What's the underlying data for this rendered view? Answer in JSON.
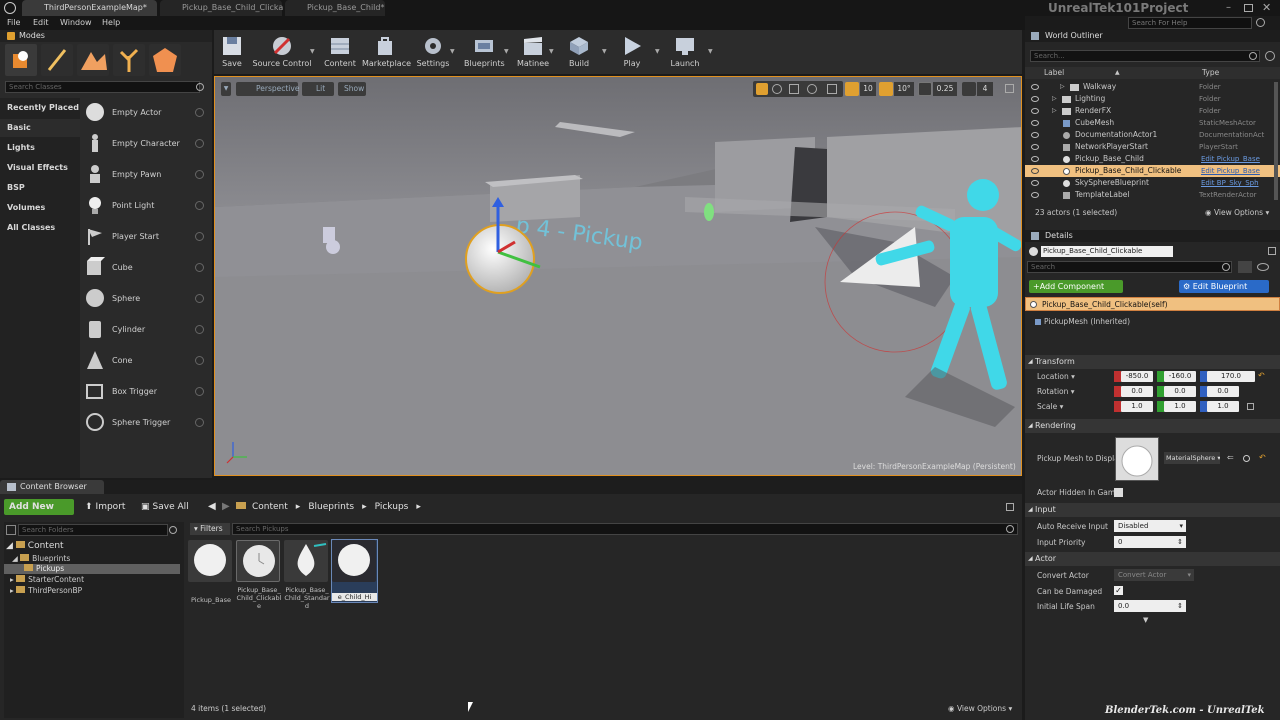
{
  "window": {
    "project": "UnrealTek101Project",
    "search_help_placeholder": "Search For Help",
    "tabs": [
      "ThirdPersonExampleMap*",
      "Pickup_Base_Child_Clicka",
      "Pickup_Base_Child*"
    ],
    "menu": [
      "File",
      "Edit",
      "Window",
      "Help"
    ]
  },
  "modes": {
    "title": "Modes",
    "search_placeholder": "Search Classes",
    "categories": [
      "Recently Placed",
      "Basic",
      "Lights",
      "Visual Effects",
      "BSP",
      "Volumes",
      "All Classes"
    ],
    "items": [
      "Empty Actor",
      "Empty Character",
      "Empty Pawn",
      "Point Light",
      "Player Start",
      "Cube",
      "Sphere",
      "Cylinder",
      "Cone",
      "Box Trigger",
      "Sphere Trigger"
    ]
  },
  "toolbar": {
    "buttons": [
      "Save",
      "Source Control",
      "Content",
      "Marketplace",
      "Settings",
      "Blueprints",
      "Matinee",
      "Build",
      "Play",
      "Launch"
    ]
  },
  "viewport": {
    "perspective": "Perspective",
    "lit": "Lit",
    "show": "Show",
    "grid_snap": "10",
    "rot_snap": "10°",
    "scale_snap": "0.25",
    "cam_speed": "4",
    "level_label": "Level:",
    "level_name": "ThirdPersonExampleMap (Persistent)"
  },
  "content_browser": {
    "title": "Content Browser",
    "add_new": "Add New",
    "import": "Import",
    "save_all": "Save All",
    "breadcrumb": [
      "Content",
      "Blueprints",
      "Pickups"
    ],
    "folder_search_placeholder": "Search Folders",
    "filters": "Filters",
    "asset_search_placeholder": "Search Pickups",
    "tree": [
      {
        "label": "Content",
        "level": 0
      },
      {
        "label": "Blueprints",
        "level": 1
      },
      {
        "label": "Pickups",
        "level": 2
      },
      {
        "label": "StarterContent",
        "level": 1
      },
      {
        "label": "ThirdPersonBP",
        "level": 1
      }
    ],
    "assets": [
      "Pickup_Base",
      "Pickup_Base_Child_Clickable",
      "Pickup_Base_Child_Standard",
      "e_Child_Hi"
    ],
    "status": "4 items (1 selected)",
    "view_options": "View Options"
  },
  "outliner": {
    "title": "World Outliner",
    "search_placeholder": "Search...",
    "col_label": "Label",
    "col_type": "Type",
    "rows": [
      {
        "label": "Walkway",
        "type": "Folder"
      },
      {
        "label": "Lighting",
        "type": "Folder"
      },
      {
        "label": "RenderFX",
        "type": "Folder"
      },
      {
        "label": "CubeMesh",
        "type": "StaticMeshActor"
      },
      {
        "label": "DocumentationActor1",
        "type": "DocumentationAct"
      },
      {
        "label": "NetworkPlayerStart",
        "type": "PlayerStart"
      },
      {
        "label": "Pickup_Base_Child",
        "type": "Edit Pickup_Base"
      },
      {
        "label": "Pickup_Base_Child_Clickable",
        "type": "Edit Pickup_Base"
      },
      {
        "label": "SkySphereBlueprint",
        "type": "Edit BP_Sky_Sph"
      },
      {
        "label": "TemplateLabel",
        "type": "TextRenderActor"
      }
    ],
    "status": "23 actors (1 selected)",
    "view_options": "View Options"
  },
  "details": {
    "title": "Details",
    "name": "Pickup_Base_Child_Clickable",
    "search_placeholder": "Search",
    "add_component": "+Add Component",
    "edit_blueprint": "Edit Blueprint",
    "components": [
      "Pickup_Base_Child_Clickable(self)",
      "PickupMesh (Inherited)"
    ],
    "transform": {
      "header": "Transform",
      "location_label": "Location",
      "rotation_label": "Rotation",
      "scale_label": "Scale",
      "location": [
        "-850.0",
        "-160.0",
        "170.0"
      ],
      "rotation": [
        "0.0",
        "0.0",
        "0.0"
      ],
      "scale": [
        "1.0",
        "1.0",
        "1.0"
      ]
    },
    "rendering": {
      "header": "Rendering",
      "mesh_label": "Pickup Mesh to Displa",
      "material": "MaterialSphere",
      "hidden_label": "Actor Hidden In Game"
    },
    "input": {
      "header": "Input",
      "auto_receive_label": "Auto Receive Input",
      "auto_receive_value": "Disabled",
      "priority_label": "Input Priority",
      "priority_value": "0"
    },
    "actor": {
      "header": "Actor",
      "convert_label": "Convert Actor",
      "convert_value": "Convert Actor",
      "damaged_label": "Can be Damaged",
      "lifespan_label": "Initial Life Span",
      "lifespan_value": "0.0"
    }
  },
  "watermark": "BlenderTek.com - UnrealTek"
}
